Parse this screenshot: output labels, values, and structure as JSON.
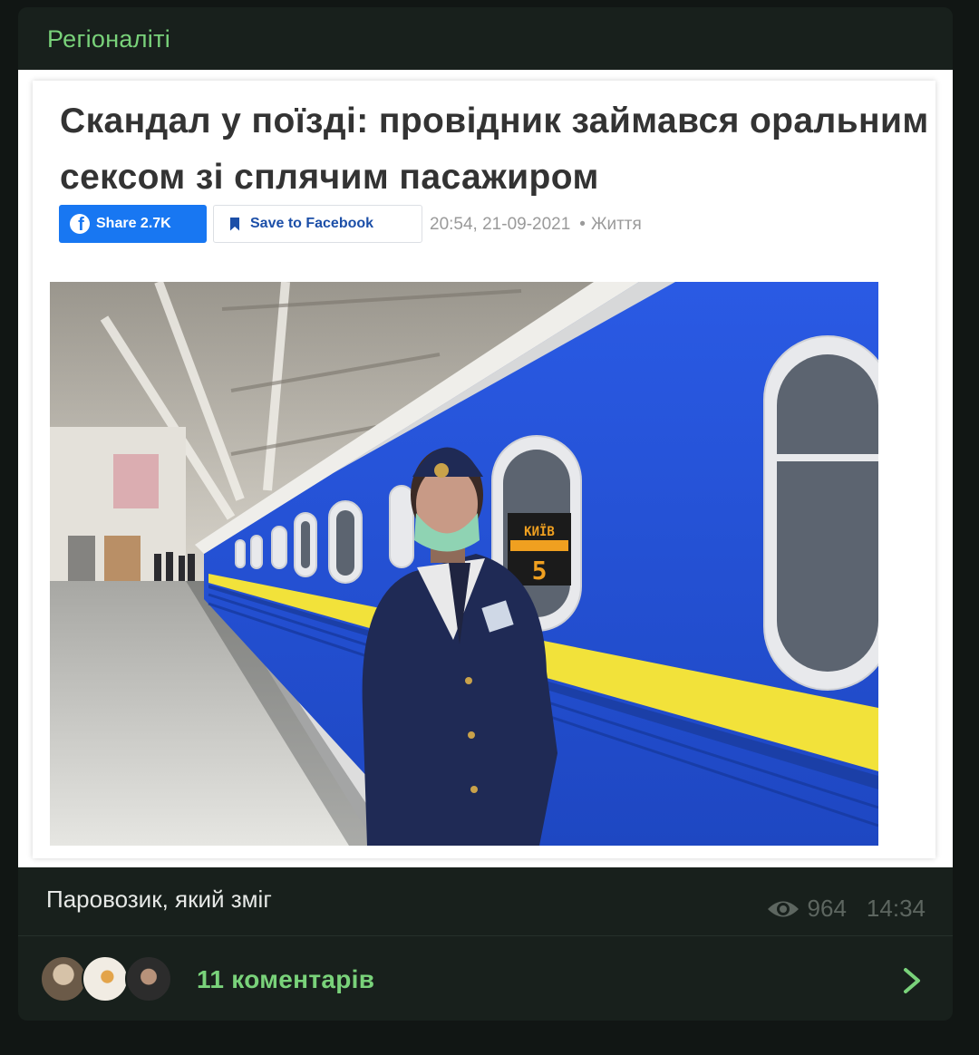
{
  "channel": {
    "name": "Регіоналіті"
  },
  "article": {
    "headline": "Скандал у поїзді: провідник займався оральним сексом зі сплячим пасажиром",
    "share_label": "Share 2.7K",
    "save_label": "Save to Facebook",
    "timestamp": "20:54, 21-09-2021",
    "category": "Життя",
    "photo_sign_text": {
      "line1": "КИЇВ",
      "line2": "5"
    }
  },
  "post": {
    "caption": "Паровозик, який зміг",
    "views": "964",
    "time": "14:34"
  },
  "comments": {
    "label": "11 коментарів"
  },
  "colors": {
    "background": "#111614",
    "card": "#18201c",
    "accent_green": "#79d27a",
    "facebook_blue": "#1877f2",
    "train_blue": "#1f4fd8",
    "train_yellow": "#f2e23a"
  },
  "icons": {
    "facebook": "facebook-icon",
    "bookmark": "bookmark-icon",
    "views": "eye-icon",
    "chevron": "chevron-right-icon"
  }
}
